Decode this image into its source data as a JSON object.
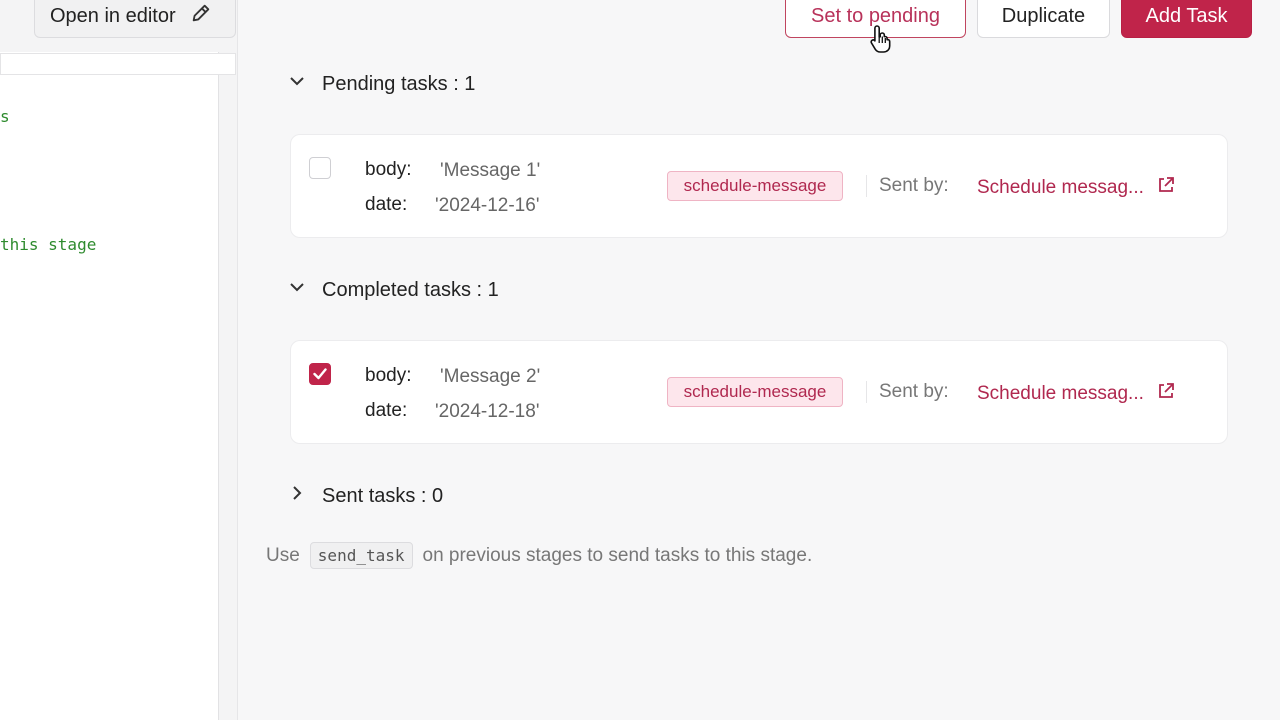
{
  "left": {
    "open_editor_label": "Open in editor",
    "code_lines": [
      "s",
      "this stage"
    ]
  },
  "toolbar": {
    "set_pending_label": "Set to pending",
    "duplicate_label": "Duplicate",
    "add_task_label": "Add Task"
  },
  "sections": {
    "pending": {
      "label": "Pending tasks : 1"
    },
    "completed": {
      "label": "Completed tasks : 1"
    },
    "sent": {
      "label": "Sent tasks : 0"
    }
  },
  "tasks": [
    {
      "checked": false,
      "body_key": "body:",
      "body_val": "'Message 1'",
      "date_key": "date:",
      "date_val": "'2024-12-16'",
      "tag": "schedule-message",
      "sent_by_label": "Sent by:",
      "sent_by_link": "Schedule messag..."
    },
    {
      "checked": true,
      "body_key": "body:",
      "body_val": "'Message 2'",
      "date_key": "date:",
      "date_val": "'2024-12-18'",
      "tag": "schedule-message",
      "sent_by_label": "Sent by:",
      "sent_by_link": "Schedule messag..."
    }
  ],
  "footer": {
    "prefix": "Use",
    "code": "send_task",
    "suffix": "on previous stages to send tasks to this stage."
  },
  "colors": {
    "accent": "#c0244a",
    "tag_bg": "#fde6ec",
    "link": "#b0284f"
  }
}
